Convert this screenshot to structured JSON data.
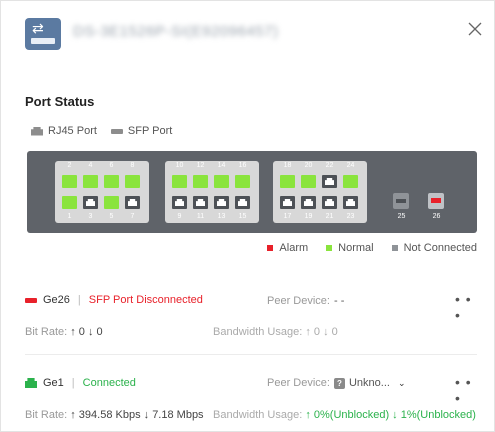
{
  "header": {
    "device_title": "DS-3E1526P-SI(E92096457)"
  },
  "section": {
    "title": "Port Status"
  },
  "port_types": {
    "rj45": "RJ45 Port",
    "sfp": "SFP Port"
  },
  "status_legend": {
    "alarm": "Alarm",
    "normal": "Normal",
    "not_connected": "Not Connected"
  },
  "colors": {
    "alarm": "#e8212a",
    "normal": "#8ae43d",
    "not_connected": "#8f9398",
    "connected_text": "#2bb24c",
    "disconnected_text": "#e8212a"
  },
  "groups": [
    {
      "top": [
        {
          "num": "2",
          "status": "normal"
        },
        {
          "num": "4",
          "status": "normal"
        },
        {
          "num": "6",
          "status": "normal"
        },
        {
          "num": "8",
          "status": "normal"
        }
      ],
      "bottom": [
        {
          "num": "1",
          "status": "normal"
        },
        {
          "num": "3",
          "status": "nc"
        },
        {
          "num": "5",
          "status": "normal"
        },
        {
          "num": "7",
          "status": "nc"
        }
      ]
    },
    {
      "top": [
        {
          "num": "10",
          "status": "normal"
        },
        {
          "num": "12",
          "status": "normal"
        },
        {
          "num": "14",
          "status": "normal"
        },
        {
          "num": "16",
          "status": "normal"
        }
      ],
      "bottom": [
        {
          "num": "9",
          "status": "nc"
        },
        {
          "num": "11",
          "status": "nc"
        },
        {
          "num": "13",
          "status": "nc"
        },
        {
          "num": "15",
          "status": "nc"
        }
      ]
    },
    {
      "top": [
        {
          "num": "18",
          "status": "normal"
        },
        {
          "num": "20",
          "status": "normal"
        },
        {
          "num": "22",
          "status": "nc"
        },
        {
          "num": "24",
          "status": "normal"
        }
      ],
      "bottom": [
        {
          "num": "17",
          "status": "nc"
        },
        {
          "num": "19",
          "status": "nc"
        },
        {
          "num": "21",
          "status": "nc"
        },
        {
          "num": "23",
          "status": "nc"
        }
      ]
    }
  ],
  "sfp_ports": [
    {
      "num": "25",
      "status": "nc"
    },
    {
      "num": "26",
      "status": "alarm"
    }
  ],
  "ports": [
    {
      "name": "Ge26",
      "status": "SFP Port Disconnected",
      "peer_label": "Peer Device:",
      "peer_value": "- -",
      "bitrate_label": "Bit Rate:",
      "bitrate_value": "↑ 0 ↓ 0",
      "bw_label": "Bandwidth Usage:",
      "bw_value": "↑ 0 ↓ 0"
    },
    {
      "name": "Ge1",
      "status": "Connected",
      "peer_label": "Peer Device:",
      "peer_value": "Unkno...",
      "bitrate_label": "Bit Rate:",
      "bitrate_value": "↑ 394.58 Kbps ↓ 7.18 Mbps",
      "bw_label": "Bandwidth Usage:",
      "bw_value": "↑ 0%(Unblocked) ↓ 1%(Unblocked)"
    }
  ],
  "more_label": "• • •",
  "icons": {
    "device": "switch-device-icon",
    "close": "close-icon",
    "more": "more-options-icon"
  }
}
